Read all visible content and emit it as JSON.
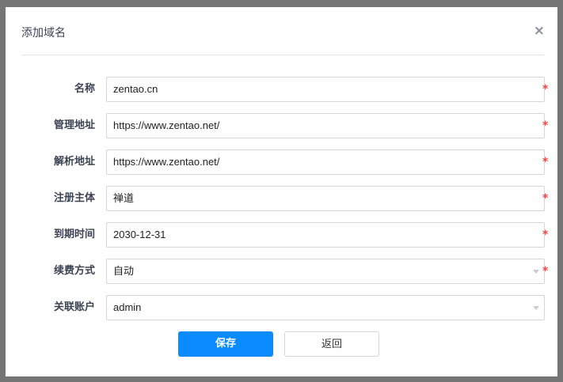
{
  "dialog": {
    "title": "添加域名",
    "close_icon": "×"
  },
  "fields": [
    {
      "label": "名称",
      "value": "zentao.cn",
      "required": true,
      "type": "text"
    },
    {
      "label": "管理地址",
      "value": "https://www.zentao.net/",
      "required": true,
      "type": "text"
    },
    {
      "label": "解析地址",
      "value": "https://www.zentao.net/",
      "required": true,
      "type": "text"
    },
    {
      "label": "注册主体",
      "value": "禅道",
      "required": true,
      "type": "text"
    },
    {
      "label": "到期时间",
      "value": "2030-12-31",
      "required": true,
      "type": "date"
    },
    {
      "label": "续费方式",
      "value": "自动",
      "required": true,
      "type": "select"
    },
    {
      "label": "关联账户",
      "value": "admin",
      "required": false,
      "type": "select"
    }
  ],
  "required_mark": "*",
  "buttons": {
    "save": "保存",
    "back": "返回"
  }
}
